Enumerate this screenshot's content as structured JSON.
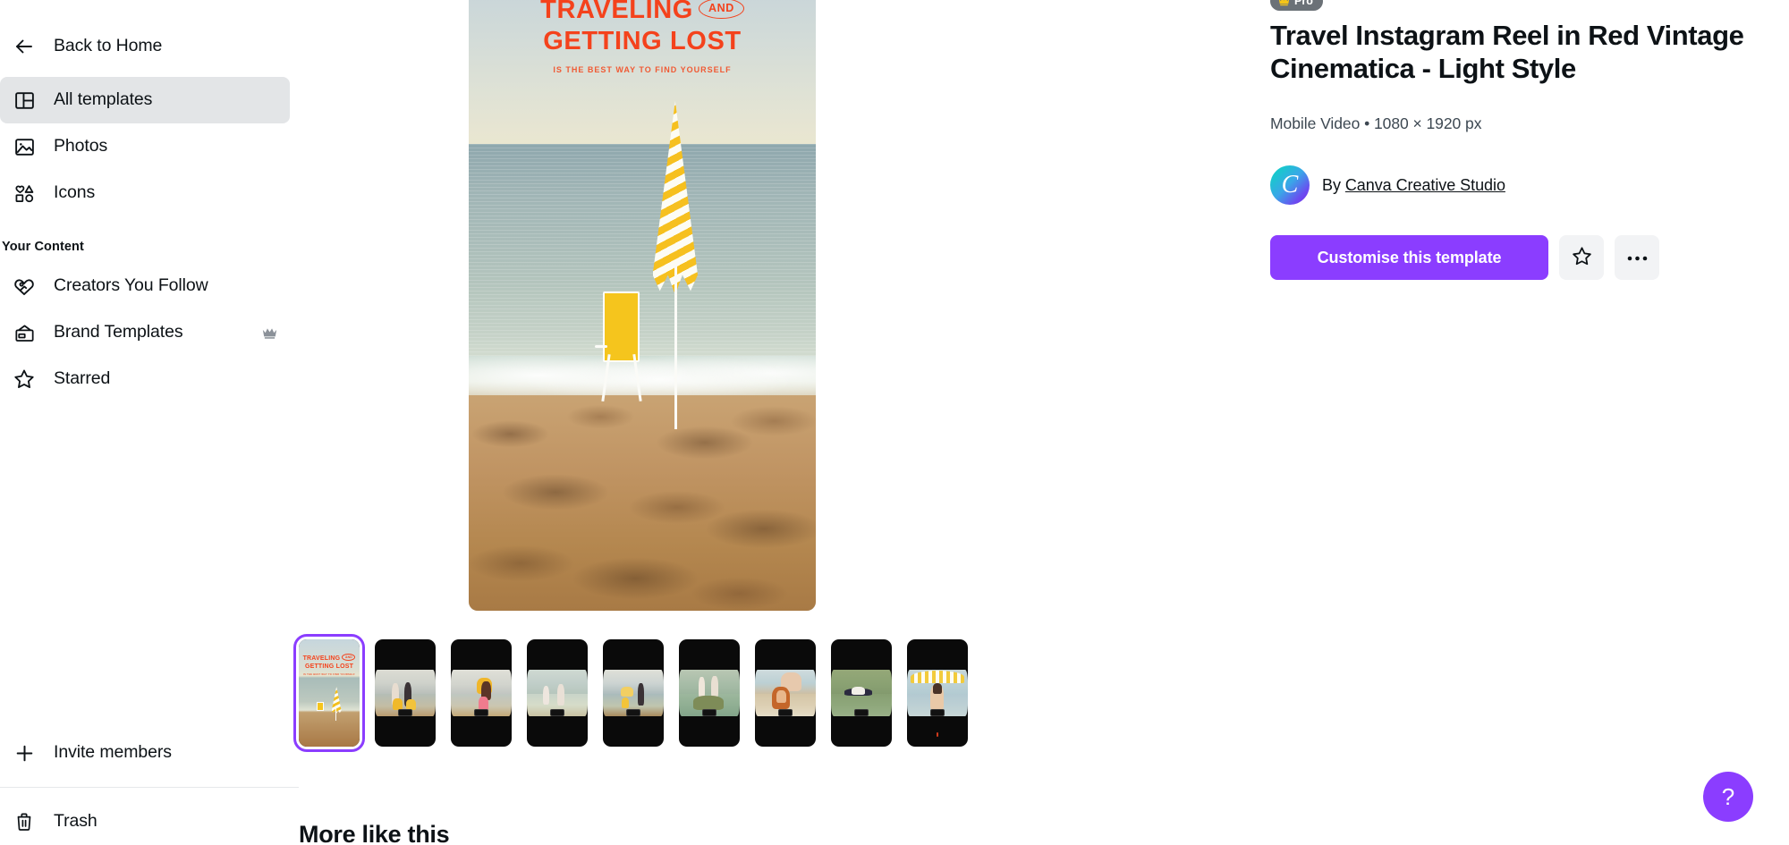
{
  "sidebar": {
    "back": {
      "label": "Back to Home",
      "icon": "arrow-left-icon"
    },
    "primary_items": [
      {
        "label": "All templates",
        "icon": "layout-templates-icon",
        "active": true
      },
      {
        "label": "Photos",
        "icon": "photo-icon",
        "active": false
      },
      {
        "label": "Icons",
        "icon": "shapes-icon",
        "active": false
      }
    ],
    "section_heading": "Your Content",
    "content_items": [
      {
        "label": "Creators You Follow",
        "icon": "heart-creators-icon",
        "badge": ""
      },
      {
        "label": "Brand Templates",
        "icon": "brand-kit-icon",
        "badge": "crown-icon"
      },
      {
        "label": "Starred",
        "icon": "star-icon",
        "badge": ""
      }
    ],
    "bottom_items": [
      {
        "label": "Invite members",
        "icon": "plus-icon"
      },
      {
        "label": "Trash",
        "icon": "trash-icon"
      }
    ]
  },
  "preview": {
    "template_headline_line1": "TRAVELING",
    "template_headline_and": "AND",
    "template_headline_line2": "GETTING LOST",
    "template_subline": "IS THE BEST WAY TO FIND YOURSELF"
  },
  "thumbnails": [
    {
      "name": "page-1-title-beach-umbrella",
      "selected": true
    },
    {
      "name": "page-2-two-women-pointing-beach",
      "selected": false
    },
    {
      "name": "page-3-woman-carrying-chair",
      "selected": false
    },
    {
      "name": "page-4-two-women-in-surf",
      "selected": false
    },
    {
      "name": "page-5-beach-umbrella-wide",
      "selected": false
    },
    {
      "name": "page-6-two-women-on-rock",
      "selected": false
    },
    {
      "name": "page-7-woman-upside-down",
      "selected": false
    },
    {
      "name": "page-8-woman-floating",
      "selected": false
    },
    {
      "name": "page-9-woman-under-umbrella",
      "selected": false
    }
  ],
  "more_like_this_heading": "More like this",
  "details": {
    "pro_badge": "Pro",
    "title": "Travel Instagram Reel in Red Vintage Cinematica - Light Style",
    "meta": "Mobile Video • 1080 × 1920 px",
    "author_prefix": "By",
    "author_name": "Canva Creative Studio",
    "avatar_letter": "C",
    "primary_button": "Customise this template",
    "star_button_icon": "star-outline-icon",
    "more_button_icon": "ellipsis-icon"
  },
  "help": {
    "label": "?",
    "icon": "question-mark-icon"
  },
  "colors": {
    "accent_purple": "#8b3dff",
    "template_red": "#f4421c",
    "sidebar_active": "#e3e5e7",
    "pro_grey": "#6b7177"
  }
}
